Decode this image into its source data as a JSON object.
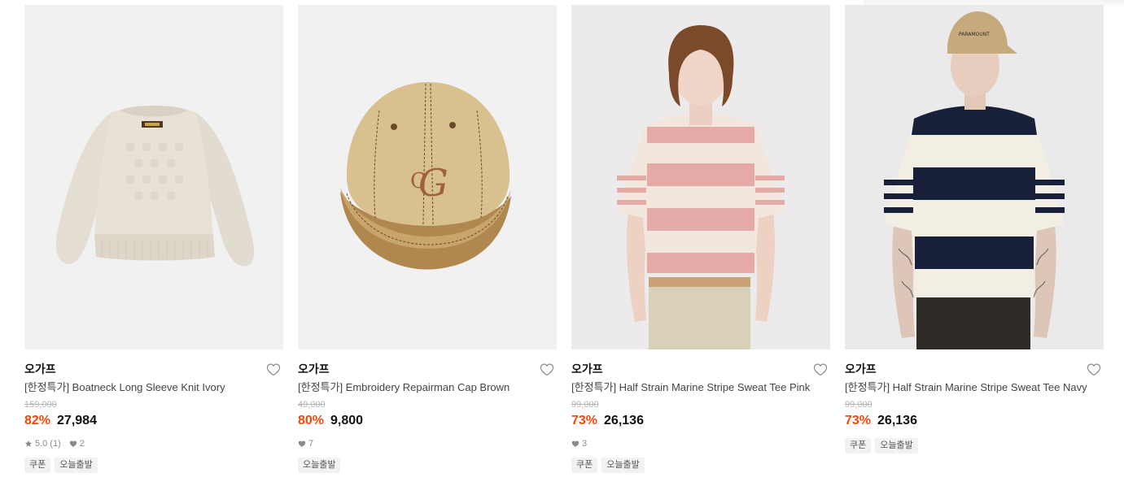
{
  "products": [
    {
      "brand": "오가프",
      "name": "[한정특가] Boatneck Long Sleeve Knit Ivory",
      "original_price": "159,000",
      "discount": "82%",
      "price": "27,984",
      "rating": "5.0",
      "review_count": "(1)",
      "likes": "2",
      "tags": [
        "쿠폰",
        "오늘출발"
      ]
    },
    {
      "brand": "오가프",
      "name": "[한정특가] Embroidery Repairman Cap Brown",
      "original_price": "49,000",
      "discount": "80%",
      "price": "9,800",
      "likes": "7",
      "tags": [
        "오늘출발"
      ]
    },
    {
      "brand": "오가프",
      "name": "[한정특가] Half Strain Marine Stripe Sweat Tee Pink",
      "original_price": "99,000",
      "discount": "73%",
      "price": "26,136",
      "likes": "3",
      "tags": [
        "쿠폰",
        "오늘출발"
      ]
    },
    {
      "brand": "오가프",
      "name": "[한정특가] Half Strain Marine Stripe Sweat Tee Navy",
      "original_price": "99,000",
      "discount": "73%",
      "price": "26,136",
      "tags": [
        "쿠폰",
        "오늘출발"
      ]
    }
  ],
  "colors": {
    "discount": "#f0480c",
    "image_bg": "#f1f1f2",
    "tag_bg": "#f2f2f2"
  },
  "icons": {
    "wishlist": "heart-outline-icon",
    "rating": "star-icon",
    "likes": "heart-filled-icon"
  }
}
